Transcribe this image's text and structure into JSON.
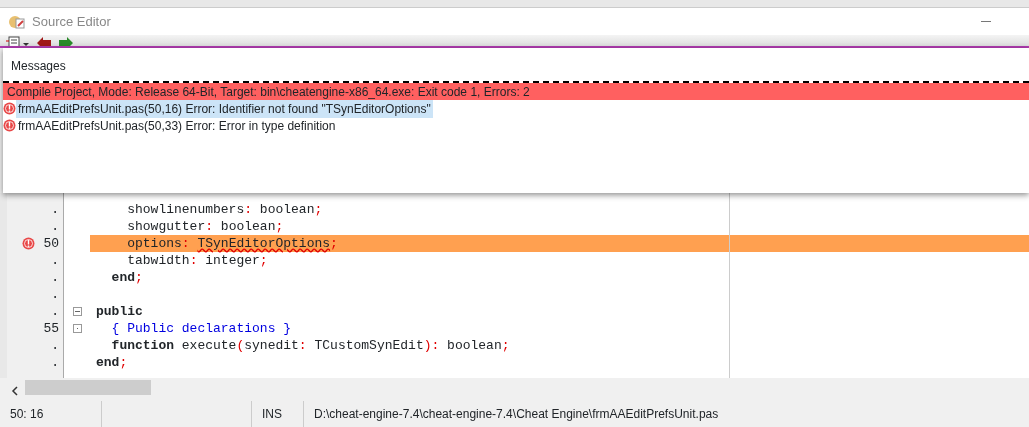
{
  "window": {
    "title": "Source Editor"
  },
  "messages": {
    "title": "Messages",
    "items": [
      {
        "kind": "header",
        "text": "Compile Project, Mode: Release 64-Bit, Target: bin\\cheatengine-x86_64.exe: Exit code 1, Errors: 2",
        "selected": false
      },
      {
        "kind": "error",
        "text": "frmAAEditPrefsUnit.pas(50,16) Error: Identifier not found \"TSynEditorOptions\"",
        "selected": true
      },
      {
        "kind": "error",
        "text": "frmAAEditPrefsUnit.pas(50,33) Error: Error in type definition",
        "selected": false
      }
    ]
  },
  "editor": {
    "lines": [
      {
        "gutter": ".",
        "error": false,
        "highlighted": false,
        "tokens": [
          {
            "kind": "id",
            "text": "    showlinenumbers"
          },
          {
            "kind": "sym",
            "text": ":"
          },
          {
            "kind": "id",
            "text": " boolean"
          },
          {
            "kind": "sym",
            "text": ";"
          }
        ]
      },
      {
        "gutter": ".",
        "error": false,
        "highlighted": false,
        "tokens": [
          {
            "kind": "id",
            "text": "    showgutter"
          },
          {
            "kind": "sym",
            "text": ":"
          },
          {
            "kind": "id",
            "text": " boolean"
          },
          {
            "kind": "sym",
            "text": ";"
          }
        ]
      },
      {
        "gutter": "50",
        "error": true,
        "highlighted": true,
        "tokens": [
          {
            "kind": "id",
            "text": "    options"
          },
          {
            "kind": "sym",
            "text": ": "
          },
          {
            "kind": "err",
            "text": "TSynEditorOptions"
          },
          {
            "kind": "sym",
            "text": ";"
          }
        ]
      },
      {
        "gutter": ".",
        "error": false,
        "highlighted": false,
        "tokens": [
          {
            "kind": "id",
            "text": "    tabwidth"
          },
          {
            "kind": "sym",
            "text": ":"
          },
          {
            "kind": "id",
            "text": " integer"
          },
          {
            "kind": "sym",
            "text": ";"
          }
        ]
      },
      {
        "gutter": ".",
        "error": false,
        "highlighted": false,
        "tokens": [
          {
            "kind": "kw",
            "text": "  end"
          },
          {
            "kind": "sym",
            "text": ";"
          }
        ]
      },
      {
        "gutter": ".",
        "error": false,
        "highlighted": false
      },
      {
        "gutter": ".",
        "error": false,
        "highlighted": false,
        "fold_marker": true,
        "expanded": true,
        "tokens": [
          {
            "kind": "kw",
            "text": "public"
          }
        ]
      },
      {
        "gutter": "55",
        "error": false,
        "highlighted": false,
        "fold_marker": true,
        "expanded": false,
        "tokens": [
          {
            "kind": "comment",
            "text": "  { Public declarations }"
          }
        ]
      },
      {
        "gutter": ".",
        "error": false,
        "highlighted": false,
        "tokens": [
          {
            "kind": "kw",
            "text": "  function"
          },
          {
            "kind": "id",
            "text": " execute"
          },
          {
            "kind": "sym",
            "text": "("
          },
          {
            "kind": "id",
            "text": "synedit"
          },
          {
            "kind": "sym",
            "text": ":"
          },
          {
            "kind": "id",
            "text": " TCustomSynEdit"
          },
          {
            "kind": "sym",
            "text": "):"
          },
          {
            "kind": "id",
            "text": " boolean"
          },
          {
            "kind": "sym",
            "text": ";"
          }
        ]
      },
      {
        "gutter": ".",
        "error": false,
        "highlighted": false,
        "tokens": [
          {
            "kind": "kw",
            "text": "end"
          },
          {
            "kind": "sym",
            "text": ";"
          }
        ]
      }
    ]
  },
  "status_bar": {
    "position": "50: 16",
    "mode": "INS",
    "file": "D:\\cheat-engine-7.4\\cheat-engine-7.4\\Cheat Engine\\frmAAEditPrefsUnit.pas"
  }
}
